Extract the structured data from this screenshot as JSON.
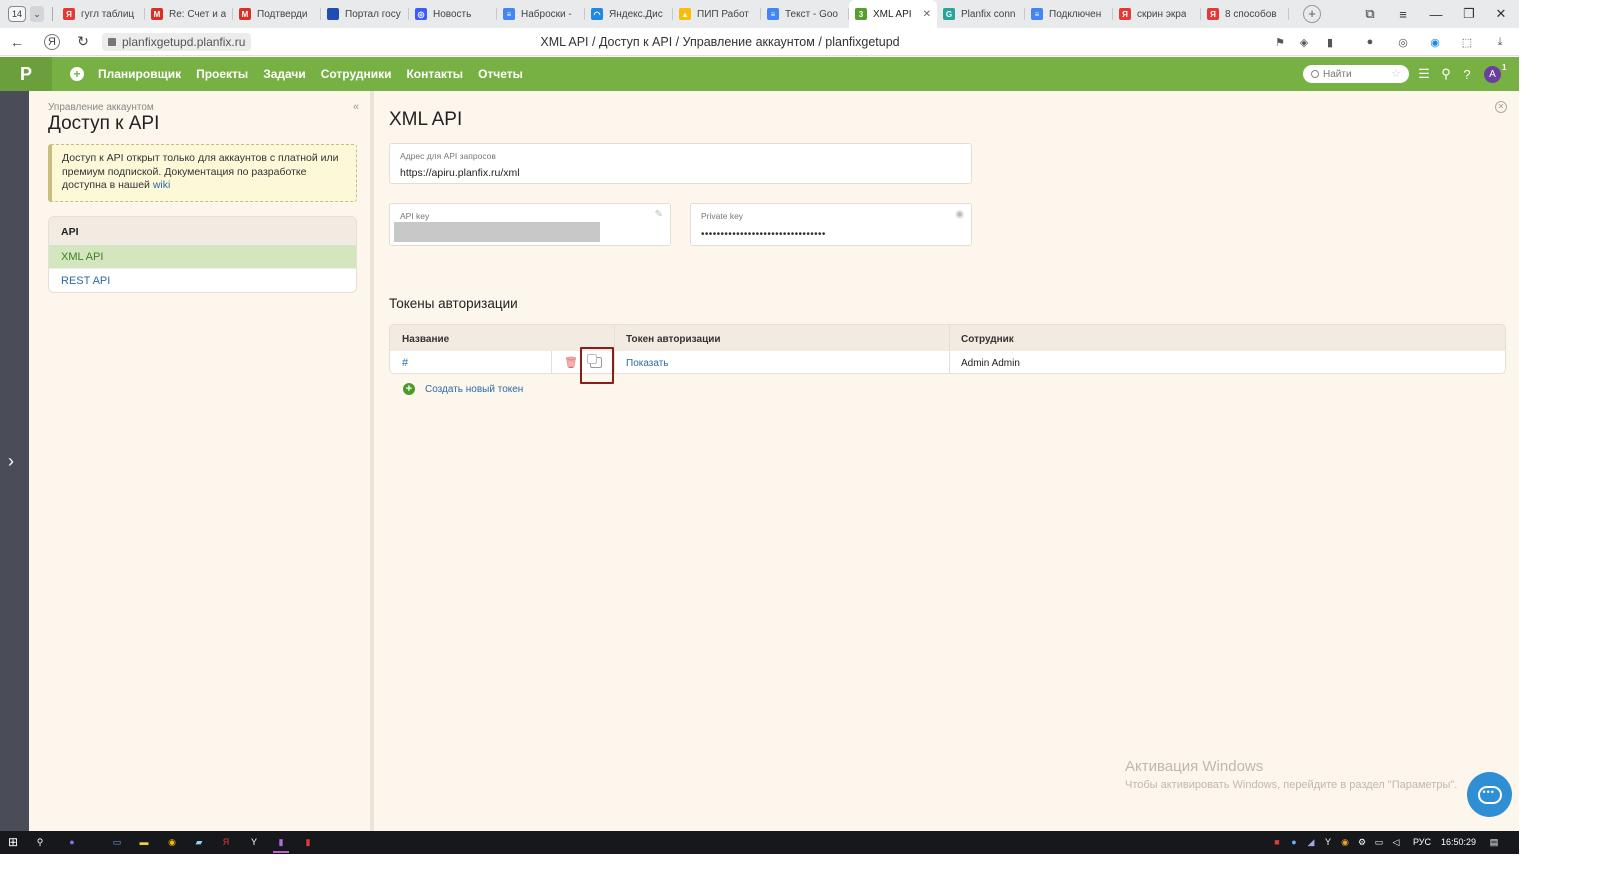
{
  "browser": {
    "tab_count": "14",
    "tabs": [
      {
        "title": "гугл таблиц",
        "icon": "yandex-icon",
        "color": "#e53935",
        "glyph": "Я"
      },
      {
        "title": "Re: Счет и а",
        "icon": "gmail-icon",
        "color": "#d93025",
        "glyph": "M"
      },
      {
        "title": "Подтверди",
        "icon": "gmail-icon",
        "color": "#d93025",
        "glyph": "M"
      },
      {
        "title": "Портал госу",
        "icon": "russia-flag-icon",
        "color": "#1e4fb0",
        "glyph": ""
      },
      {
        "title": "Новость",
        "icon": "news-icon",
        "color": "#3d5afe",
        "glyph": "◎"
      },
      {
        "title": "Наброски -",
        "icon": "docs-icon",
        "color": "#4285f4",
        "glyph": "≡"
      },
      {
        "title": "Яндекс.Дис",
        "icon": "yandex-disk-icon",
        "color": "#1e88e5",
        "glyph": "◠"
      },
      {
        "title": "ПИП Работ",
        "icon": "gdrive-icon",
        "color": "#fbbc04",
        "glyph": "▲"
      },
      {
        "title": "Текст - Goo",
        "icon": "docs-icon",
        "color": "#4285f4",
        "glyph": "≡"
      },
      {
        "title": "XML API",
        "icon": "planfix-icon",
        "color": "#55a02a",
        "glyph": "3",
        "active": true
      },
      {
        "title": "Planfix conn",
        "icon": "planfix-conn-icon",
        "color": "#26a69a",
        "glyph": "G"
      },
      {
        "title": "Подключен",
        "icon": "docs-icon",
        "color": "#4285f4",
        "glyph": "≡"
      },
      {
        "title": "скрин экра",
        "icon": "yandex-icon",
        "color": "#e53935",
        "glyph": "Я"
      },
      {
        "title": "8 способов",
        "icon": "article-icon",
        "color": "#e53935",
        "glyph": "Я"
      }
    ],
    "url": "planfixgetupd.planfix.ru",
    "page_title": "XML API / Доступ к API / Управление аккаунтом / planfixgetupd"
  },
  "nav": {
    "logo": "P",
    "items": [
      "Планировщик",
      "Проекты",
      "Задачи",
      "Сотрудники",
      "Контакты",
      "Отчеты"
    ],
    "search_placeholder": "Найти",
    "avatar_letter": "A",
    "avatar_badge": "1"
  },
  "sidebar": {
    "breadcrumb": "Управление аккаунтом",
    "title": "Доступ к API",
    "notice_text": "Доступ к API открыт только для аккаунтов с платной или премиум подпиской. Документация по разработке доступна в нашей",
    "notice_link": "wiki",
    "menu_header": "API",
    "menu_items": [
      {
        "label": "XML API",
        "active": true
      },
      {
        "label": "REST API",
        "active": false
      }
    ]
  },
  "content": {
    "title": "XML API",
    "api_address_label": "Адрес для API запросов",
    "api_address_value": "https://apiru.planfix.ru/xml",
    "api_key_label": "API key",
    "private_key_label": "Private key",
    "private_key_value": "••••••••••••••••••••••••••••••••",
    "tokens_title": "Токены авторизации",
    "table": {
      "headers": [
        "Название",
        "Токен авторизации",
        "Сотрудник"
      ],
      "rows": [
        {
          "name": "#",
          "token": "Показать",
          "employee": "Admin Admin"
        }
      ]
    },
    "create_token_label": "Создать новый токен"
  },
  "watermark": {
    "line1": "Активация Windows",
    "line2": "Чтобы активировать Windows, перейдите в раздел \"Параметры\"."
  },
  "taskbar": {
    "language": "РУС",
    "time": "16:50:29"
  },
  "colors": {
    "brand_green": "#77b144",
    "highlight": "#8a1c1c",
    "link": "#2b6aa6"
  }
}
